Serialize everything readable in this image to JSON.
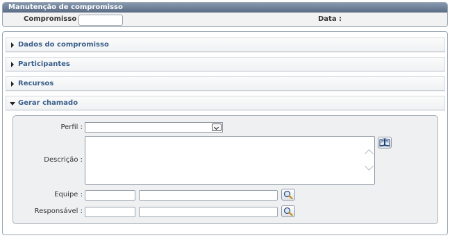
{
  "header": {
    "title": "Manutenção de compromisso",
    "compromisso_label": "Compromisso :",
    "compromisso_value": "",
    "data_label": "Data :"
  },
  "sections": [
    {
      "label": "Dados do compromisso",
      "expanded": false
    },
    {
      "label": "Participantes",
      "expanded": false
    },
    {
      "label": "Recursos",
      "expanded": false
    },
    {
      "label": "Gerar chamado",
      "expanded": true
    }
  ],
  "form": {
    "perfil_label": "Perfil :",
    "perfil_value": "",
    "descricao_label": "Descrição :",
    "descricao_value": "",
    "equipe_label": "Equipe :",
    "equipe_code": "",
    "equipe_name": "",
    "responsavel_label": "Responsável :",
    "responsavel_code": "",
    "responsavel_name": ""
  },
  "icons": {
    "book": "book-icon",
    "search": "magnifier-icon"
  },
  "colors": {
    "title_bar": "#6f8299",
    "section_text": "#3a5f8a",
    "border": "#9aa6b4"
  }
}
